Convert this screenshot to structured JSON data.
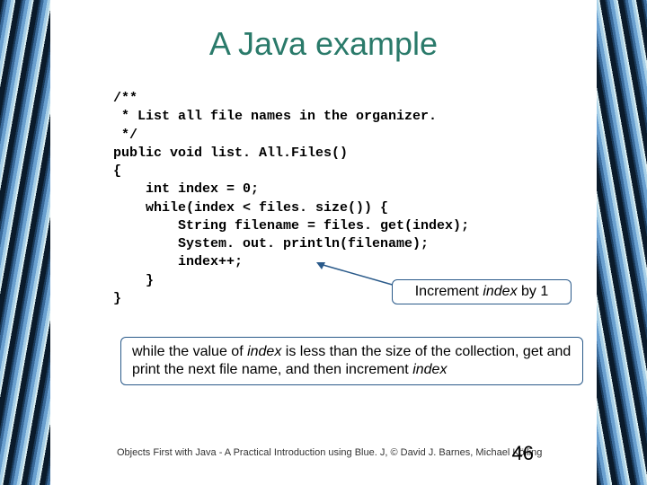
{
  "title": "A Java example",
  "code_lines": [
    "/**",
    " * List all file names in the organizer.",
    " */",
    "public void list. All.Files()",
    "{",
    "    int index = 0;",
    "    while(index < files. size()) {",
    "        String filename = files. get(index);",
    "        System. out. println(filename);",
    "        index++;",
    "    }",
    "}"
  ],
  "annotation1": {
    "prefix": "Increment ",
    "italic": "index",
    "suffix": " by 1"
  },
  "annotation2": {
    "part1": "while the value of ",
    "italic1": "index",
    "part2": " is less than the size of the collection, get and print the next file name, and then increment ",
    "italic2": "index"
  },
  "footer": "Objects First with Java - A  Practical Introduction using Blue. J, © David J. Barnes, Michael Kölling",
  "page_number": "46"
}
